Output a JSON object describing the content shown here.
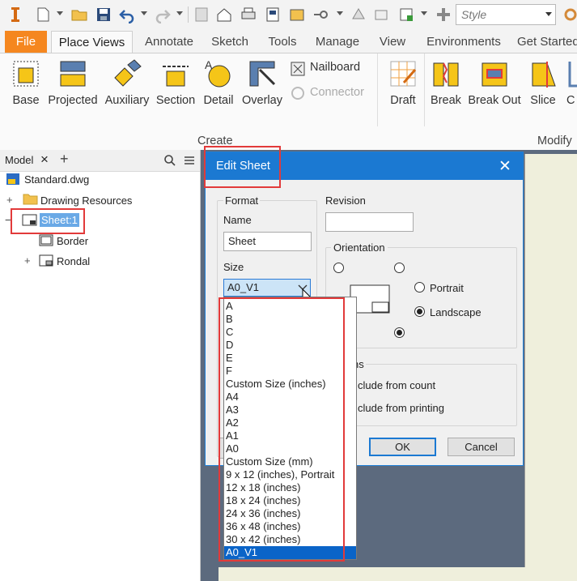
{
  "quick_access": {
    "style_placeholder": "Style"
  },
  "tabs": [
    "File",
    "Place Views",
    "Annotate",
    "Sketch",
    "Tools",
    "Manage",
    "View",
    "Environments",
    "Get Started"
  ],
  "ribbon": {
    "create_buttons": [
      "Base",
      "Projected",
      "Auxiliary",
      "Section",
      "Detail",
      "Overlay"
    ],
    "nailboard": "Nailboard",
    "connector": "Connector",
    "draft": "Draft",
    "modify_buttons": [
      "Break",
      "Break Out",
      "Slice",
      "C"
    ],
    "group_create": "Create",
    "group_modify": "Modify"
  },
  "browser": {
    "tab": "Model",
    "close": "×",
    "add": "+",
    "items": {
      "root": "Standard.dwg",
      "resources": "Drawing Resources",
      "sheet": "Sheet:1",
      "border": "Border",
      "rondal": "Rondal"
    }
  },
  "dialog": {
    "title": "Edit Sheet",
    "close": "✕",
    "format_label": "Format",
    "name_label": "Name",
    "name_value": "Sheet",
    "size_label": "Size",
    "size_value": "A0_V1",
    "revision_label": "Revision",
    "revision_value": "",
    "orientation_label": "Orientation",
    "portrait_label": "Portrait",
    "landscape_label": "Landscape",
    "options_label_fragment": "ns",
    "exclude_count_fragment": "clude from count",
    "exclude_print_fragment": "clude from printing",
    "ok_label": "OK",
    "cancel_label": "Cancel"
  },
  "size_options": [
    "A",
    "B",
    "C",
    "D",
    "E",
    "F",
    "Custom Size (inches)",
    "A4",
    "A3",
    "A2",
    "A1",
    "A0",
    "Custom Size (mm)",
    "9 x 12 (inches), Portrait",
    "12 x 18 (inches)",
    "18 x 24 (inches)",
    "24 x 36 (inches)",
    "36 x 48 (inches)",
    "30 x 42 (inches)",
    "A0_V1"
  ],
  "colors": {
    "accent_blue": "#1b79d2",
    "file_tab": "#f5871f",
    "highlight_red": "#e23a3a",
    "selected_option": "#0a64c8"
  }
}
